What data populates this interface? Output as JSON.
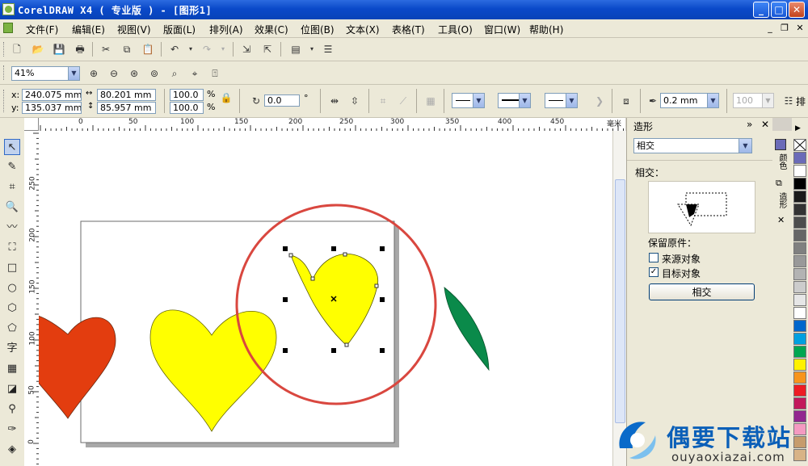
{
  "window": {
    "title": "CorelDRAW X4 ( 专业版 ) - [图形1]",
    "min": "_",
    "max": "□",
    "close": "✕"
  },
  "menu": [
    "文件(F)",
    "编辑(E)",
    "视图(V)",
    "版面(L)",
    "排列(A)",
    "效果(C)",
    "位图(B)",
    "文本(X)",
    "表格(T)",
    "工具(O)",
    "窗口(W)",
    "帮助(H)"
  ],
  "mdi": {
    "min": "_",
    "restore": "❐",
    "close": "✕"
  },
  "zoom": "41%",
  "property_bar": {
    "x_label": "x:",
    "x_value": "240.075 mm",
    "y_label": "y:",
    "y_value": "135.037 mm",
    "w_value": "80.201 mm",
    "h_value": "85.957 mm",
    "scale_x": "100.0",
    "scale_y": "100.0",
    "percent": "%",
    "rotation": "0.0",
    "degree": "°",
    "outline_width": "0.2 mm",
    "opacity_value": "100",
    "trailing_label": "排"
  },
  "ruler": {
    "h_labels": [
      "0",
      "50",
      "100",
      "150",
      "200",
      "250",
      "300",
      "350",
      "400",
      "450",
      "毫米"
    ],
    "v_labels": [
      "250",
      "200",
      "150",
      "100",
      "50",
      "0"
    ]
  },
  "docker": {
    "title": "造形",
    "mode": "相交",
    "section_label": "相交：",
    "keep_originals": "保留原件：",
    "source_object": {
      "label": "来源对象",
      "checked": false
    },
    "target_object": {
      "label": "目标对象",
      "checked": true
    },
    "apply_button": "相交"
  },
  "side_tabs": [
    "颜色",
    "造形"
  ],
  "palette": [
    "#6b6bb8",
    "#ffffff",
    "#000000",
    "#1a1a1a",
    "#333333",
    "#4d4d4d",
    "#666666",
    "#808080",
    "#999999",
    "#b3b3b3",
    "#cccccc",
    "#e6e6e6",
    "#ffffff",
    "#0066cc",
    "#00a0e0",
    "#00a651",
    "#fff200",
    "#f7941d",
    "#ed1c24",
    "#c2185b",
    "#92278f",
    "#f49ac1",
    "#c69c6d",
    "#d8b386"
  ],
  "watermark": {
    "brand": "偶要下载站",
    "url": "ouyaoxiazai.com"
  },
  "colors": {
    "heart_red": "#e33d0f",
    "heart_yellow": "#ffff00",
    "leaf_green": "#0a8a4a",
    "circle_red": "#d9473f",
    "title_blue": "#0a49c9"
  }
}
